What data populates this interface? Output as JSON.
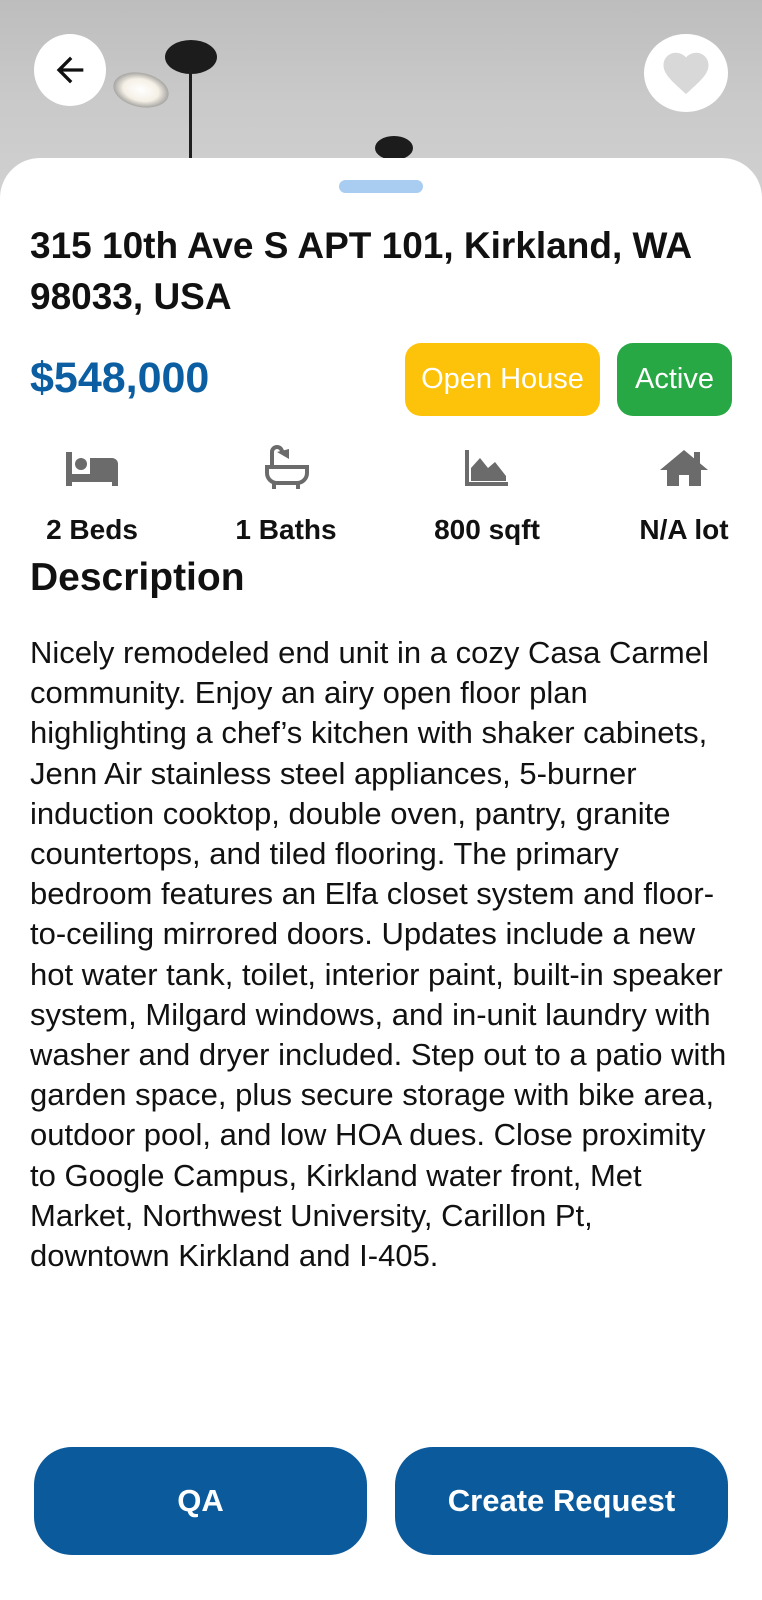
{
  "listing": {
    "address": "315 10th Ave S APT 101, Kirkland, WA 98033, USA",
    "price": "$548,000",
    "badges": {
      "open_house": "Open House",
      "status": "Active"
    },
    "stats": {
      "beds": "2 Beds",
      "baths": "1 Baths",
      "sqft": "800 sqft",
      "lot": "N/A lot"
    },
    "description_title": "Description",
    "description": "Nicely remodeled end unit in a cozy Casa Carmel community. Enjoy an airy open floor plan highlighting a chef’s kitchen with shaker cabinets, Jenn Air stainless steel appliances, 5-burner induction cooktop, double oven, pantry, granite countertops, and tiled flooring. The primary bedroom features an Elfa closet system and floor-to-ceiling mirrored doors. Updates include a new hot water tank, toilet, interior paint, built-in speaker system, Milgard windows, and in-unit laundry with washer and dryer included. Step out to a patio with garden space, plus secure storage with bike area, outdoor pool, and low HOA dues. Close proximity to Google Campus, Kirkland water front, Met Market, Northwest University, Carillon Pt, downtown Kirkland and I-405."
  },
  "actions": {
    "qa_label": "QA",
    "create_request_label": "Create Request"
  },
  "icons": {
    "back": "arrow-left-icon",
    "favorite": "heart-icon",
    "beds": "bed-icon",
    "baths": "bathtub-icon",
    "sqft": "area-chart-icon",
    "lot": "home-icon"
  },
  "colors": {
    "primary": "#0b5a9b",
    "price": "#0b5ea1",
    "open_house": "#fdc30a",
    "active": "#28a745",
    "handle": "#a8cdf0",
    "icon_gray": "#6b6b6b"
  }
}
